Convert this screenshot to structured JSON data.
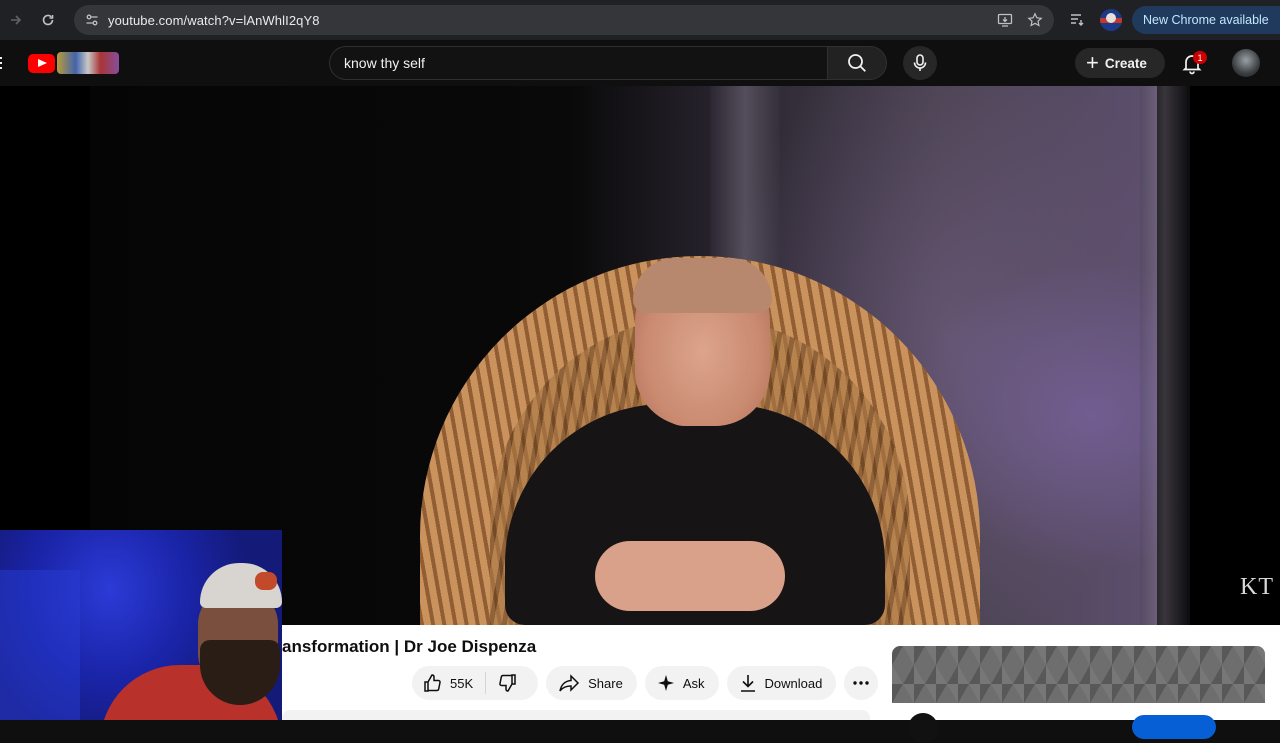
{
  "browser": {
    "url": "youtube.com/watch?v=lAnWhlI2qY8",
    "update_button": "New Chrome available"
  },
  "youtube": {
    "search": {
      "value": "know thy self"
    },
    "create_label": "Create",
    "notification_count": "1"
  },
  "video": {
    "watermark": "KT",
    "title": "ansformation | Dr Joe Dispenza",
    "actions": {
      "like_count": "55K",
      "share_label": "Share",
      "ask_label": "Ask",
      "download_label": "Download"
    }
  },
  "colors": {
    "brand_red": "#ff0000",
    "chrome_update": "#1f3a5c",
    "subscribe_blue": "#065fd4"
  }
}
